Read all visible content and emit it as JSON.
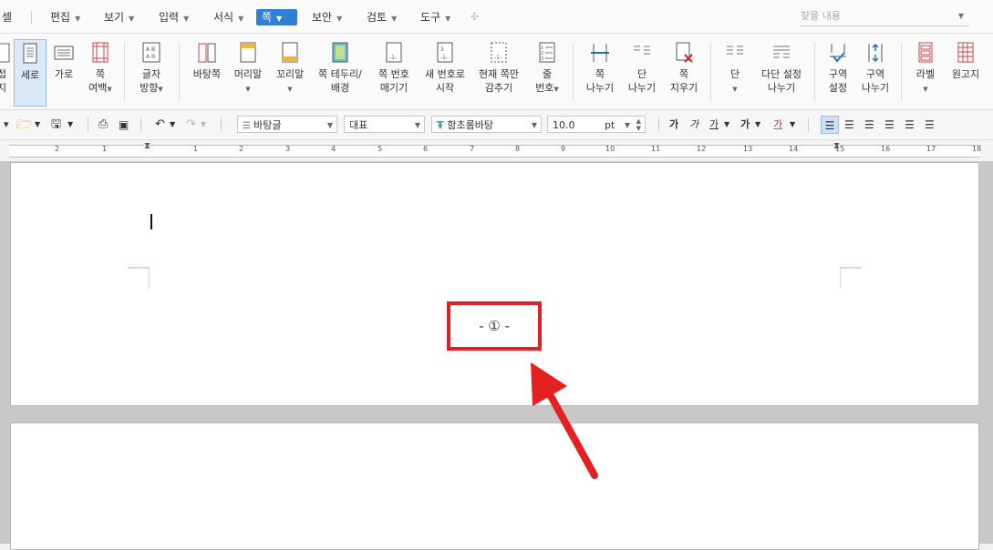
{
  "menubar": {
    "items": [
      {
        "label": "편집"
      },
      {
        "label": "보기"
      },
      {
        "label": "입력"
      },
      {
        "label": "서식"
      },
      {
        "label": "쪽"
      },
      {
        "label": "보안"
      },
      {
        "label": "검토"
      },
      {
        "label": "도구"
      }
    ],
    "left_fragment": "셀",
    "search_placeholder": "찾을 내용"
  },
  "ribbon": {
    "cutoff_label_1": "접",
    "cutoff_label_2": "지",
    "vertical": "세로",
    "horizontal": "가로",
    "margin_1": "쪽",
    "margin_2": "여백",
    "text_dir_1": "글자",
    "text_dir_2": "방향",
    "bg_page": "바탕쪽",
    "header": "머리말",
    "footer": "꼬리말",
    "border_1": "쪽 테두리/",
    "border_2": "배경",
    "pagenum_1": "쪽 번호",
    "pagenum_2": "매기기",
    "newnum_1": "새 번호로",
    "newnum_2": "시작",
    "hide_1": "현재 쪽만",
    "hide_2": "감추기",
    "line_1": "줄",
    "line_2": "번호",
    "pagebreak_1": "쪽",
    "pagebreak_2": "나누기",
    "colbreak_1": "단",
    "colbreak_2": "나누기",
    "delpage_1": "쪽",
    "delpage_2": "지우기",
    "column": "단",
    "multicol_1": "다단 설정",
    "multicol_2": "나누기",
    "section_1": "구역",
    "section_2": "설정",
    "secbreak_1": "구역",
    "secbreak_2": "나누기",
    "label": "라벨",
    "manuscript": "원고지"
  },
  "toolbar": {
    "style": "바탕글",
    "lang": "대표",
    "font": "함초롬바탕",
    "size": "10.0",
    "unit": "pt",
    "ga1": "가",
    "ga2": "가",
    "ga3": "가",
    "ga4": "가",
    "ga5": "가"
  },
  "ruler": {
    "numbers": [
      "2",
      "1",
      "1",
      "2",
      "3",
      "4",
      "5",
      "6",
      "7",
      "8",
      "9",
      "10",
      "11",
      "12",
      "13",
      "14",
      "15",
      "16",
      "17",
      "18"
    ]
  },
  "document": {
    "page_number_text": "- ① -"
  },
  "colors": {
    "accent": "#2f7fd3",
    "highlight": "#e02020"
  }
}
